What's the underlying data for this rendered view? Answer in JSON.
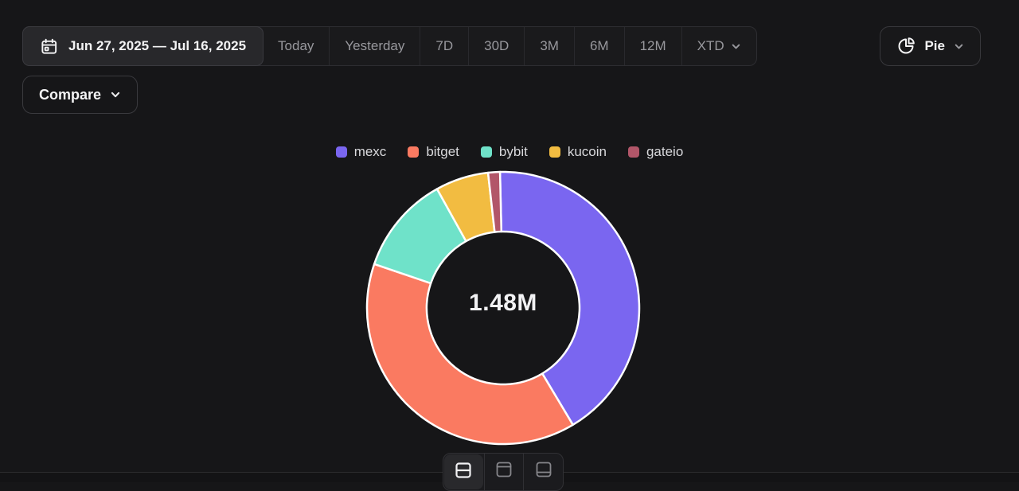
{
  "toolbar": {
    "date_range": "Jun 27, 2025 — Jul 16, 2025",
    "ranges": [
      "Today",
      "Yesterday",
      "7D",
      "30D",
      "3M",
      "6M",
      "12M"
    ],
    "xtd_label": "XTD",
    "chart_type_label": "Pie",
    "compare_label": "Compare"
  },
  "chart_data": {
    "type": "pie",
    "donut": true,
    "total_label": "1.48M",
    "legend_position": "top",
    "series": [
      {
        "name": "mexc",
        "percent": 41.8,
        "color": "#7A66F0"
      },
      {
        "name": "bitget",
        "percent": 38.8,
        "color": "#FA7A61"
      },
      {
        "name": "bybit",
        "percent": 11.7,
        "color": "#6FE2C9"
      },
      {
        "name": "kucoin",
        "percent": 6.3,
        "color": "#F2BC41"
      },
      {
        "name": "gateio",
        "percent": 1.4,
        "color": "#B25669"
      }
    ]
  },
  "layout_switcher": {
    "options": [
      "split-rows-view",
      "top-panel-view",
      "bottom-panel-view"
    ],
    "active": "split-rows-view"
  },
  "icons": [
    "calendar-icon",
    "chevron-down-icon",
    "pie-chart-icon",
    "split-rows-icon",
    "top-panel-icon",
    "bottom-panel-icon"
  ],
  "colors": {
    "background": "#161618",
    "panel": "#1a1a1c",
    "selected_segment": "#28282b",
    "border": "#2d2d31",
    "text_primary": "#f4f4f5",
    "text_muted": "#98989d",
    "slice_stroke": "#ffffff"
  }
}
